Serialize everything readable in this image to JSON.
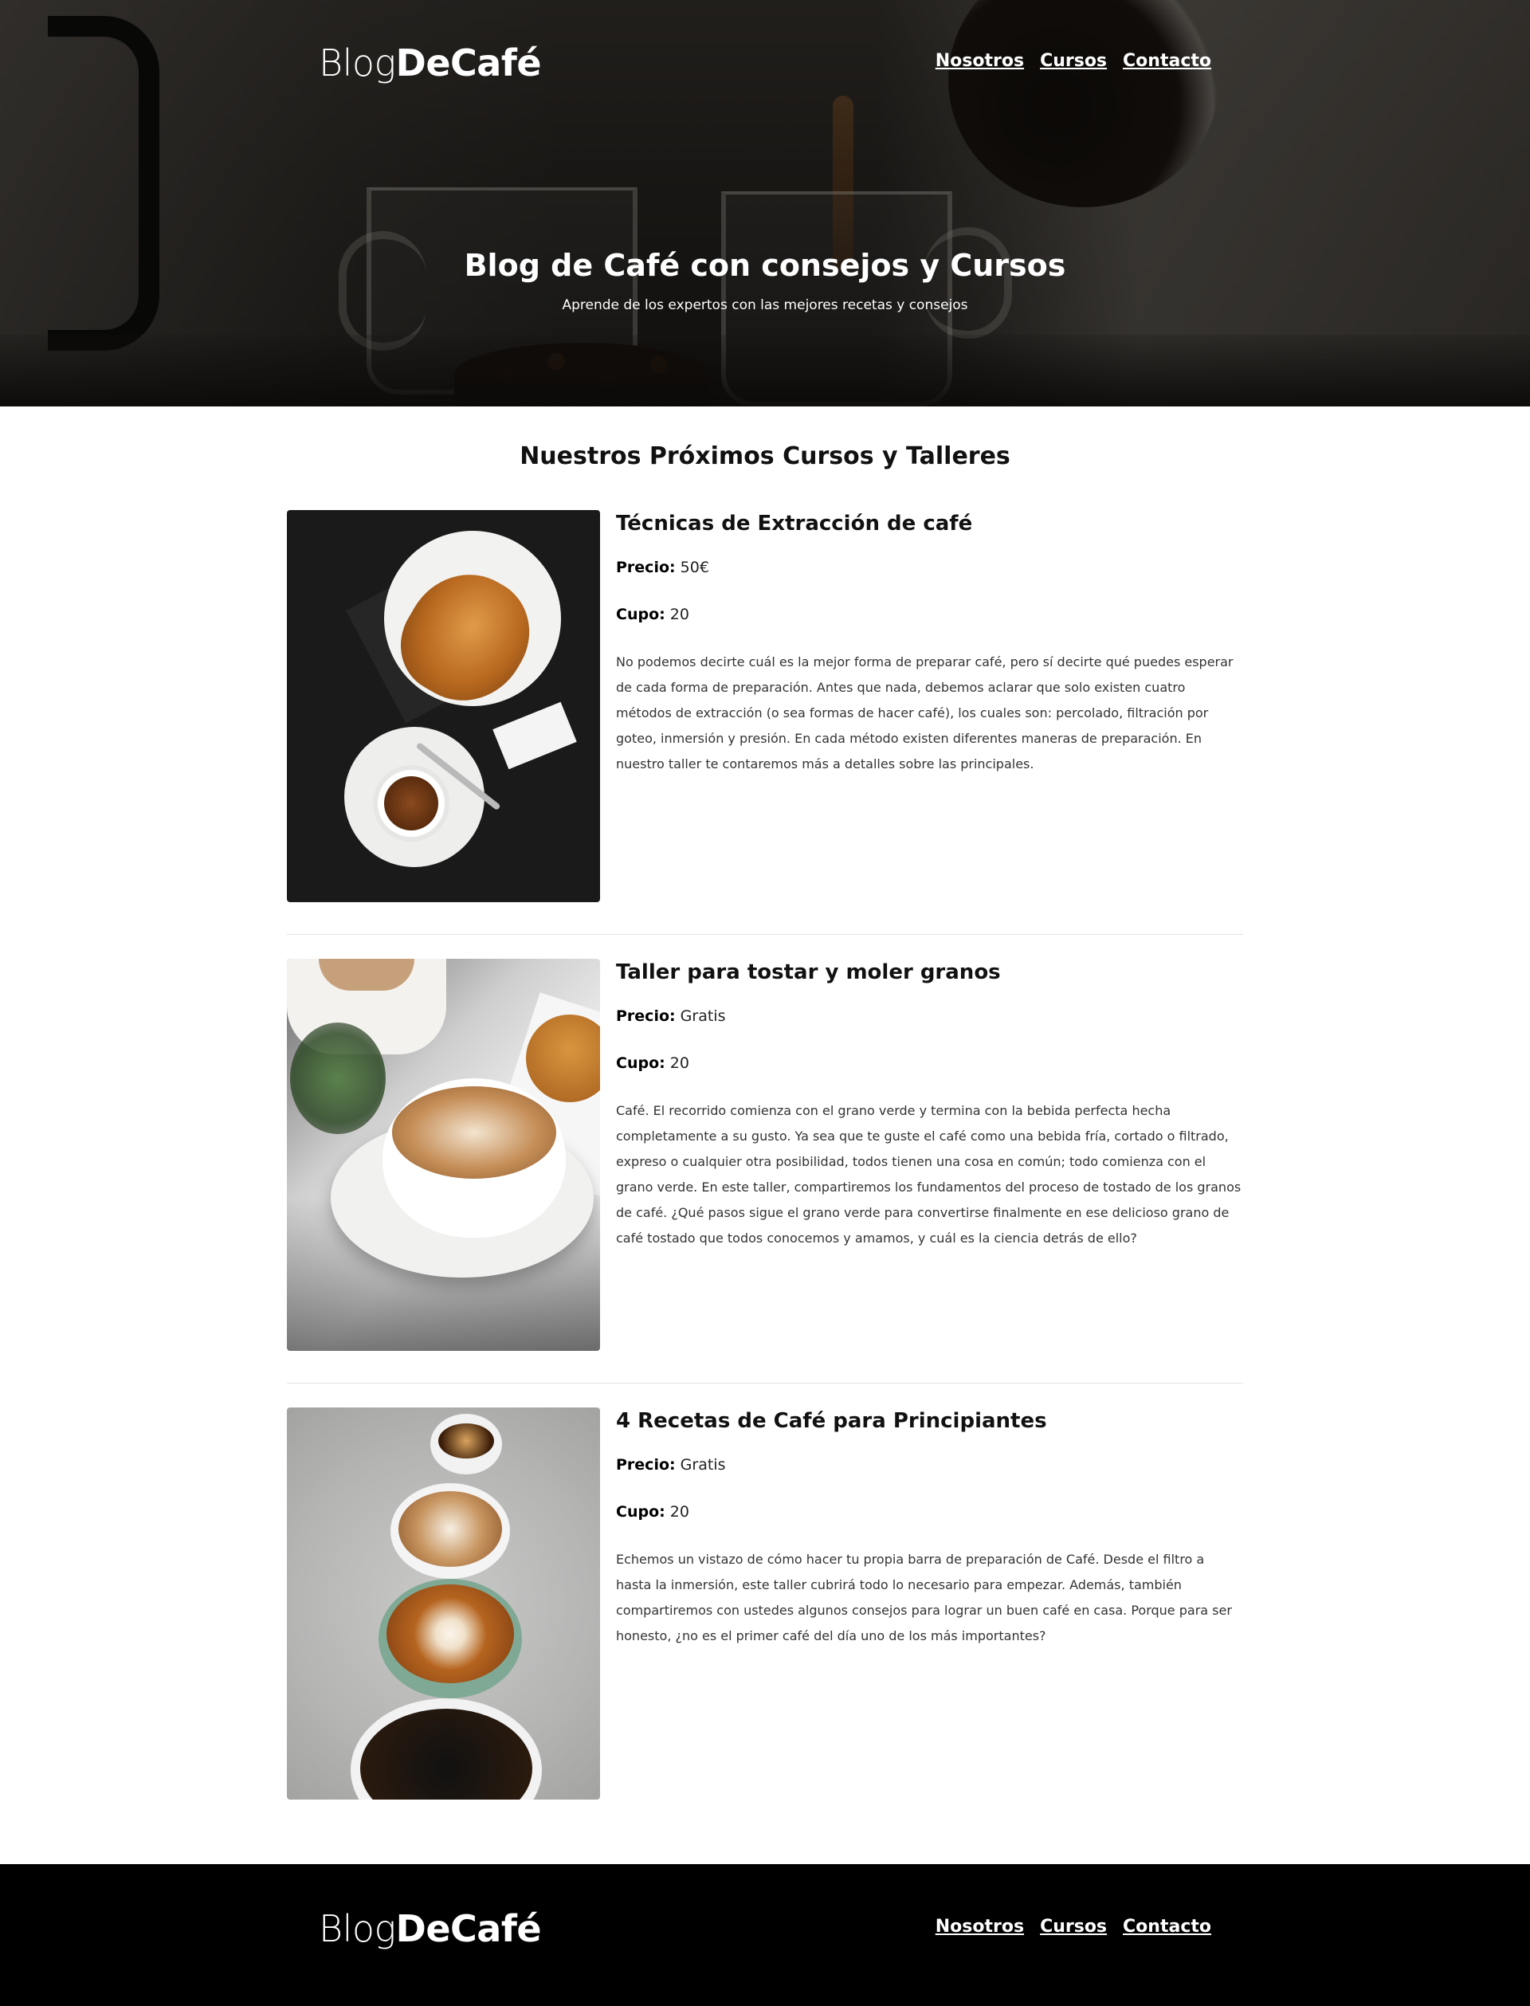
{
  "header": {
    "logo_light": "Blog",
    "logo_bold": "DeCafé",
    "nav": [
      {
        "label": "Nosotros"
      },
      {
        "label": "Cursos"
      },
      {
        "label": "Contacto"
      }
    ]
  },
  "hero": {
    "title": "Blog de Café con consejos y Cursos",
    "subtitle": "Aprende de los expertos con las mejores recetas y consejos"
  },
  "main": {
    "section_title": "Nuestros Próximos Cursos y Talleres",
    "price_label": "Precio:",
    "quota_label": "Cupo:",
    "courses": [
      {
        "title": "Técnicas de Extracción de café",
        "price": "50€",
        "quota": "20",
        "description": "No podemos decirte cuál es la mejor forma de preparar café, pero sí decirte qué puedes esperar de cada forma de preparación. Antes que nada, debemos aclarar que solo existen cuatro métodos de extracción (o sea formas de hacer café), los cuales son: percolado, filtración por goteo, inmersión y presión. En cada método existen diferentes maneras de preparación. En nuestro taller te contaremos más a detalles sobre las principales."
      },
      {
        "title": "Taller para tostar y moler granos",
        "price": "Gratis",
        "quota": "20",
        "description": "Café. El recorrido comienza con el grano verde y termina con la bebida perfecta hecha completamente a su gusto. Ya sea que te guste el café como una bebida fría, cortado o filtrado, expreso o cualquier otra posibilidad, todos tienen una cosa en común; todo comienza con el grano verde. En este taller, compartiremos los fundamentos del proceso de tostado de los granos de café. ¿Qué pasos sigue el grano verde para convertirse finalmente en ese delicioso grano de café tostado que todos conocemos y amamos, y cuál es la ciencia detrás de ello?"
      },
      {
        "title": "4 Recetas de Café para Principiantes",
        "price": "Gratis",
        "quota": "20",
        "description": "Echemos un vistazo de cómo hacer tu propia barra de preparación de Café. Desde el filtro a hasta la inmersión, este taller cubrirá todo lo necesario para empezar. Además, también compartiremos con ustedes algunos consejos para lograr un buen café en casa. Porque para ser honesto, ¿no es el primer café del día uno de los más importantes?"
      }
    ]
  },
  "footer": {
    "logo_light": "Blog",
    "logo_bold": "DeCafé",
    "nav": [
      {
        "label": "Nosotros"
      },
      {
        "label": "Cursos"
      },
      {
        "label": "Contacto"
      }
    ]
  },
  "colors": {
    "footer_bg": "#000000",
    "text": "#1a1a1a",
    "divider": "#e4e4e4"
  }
}
